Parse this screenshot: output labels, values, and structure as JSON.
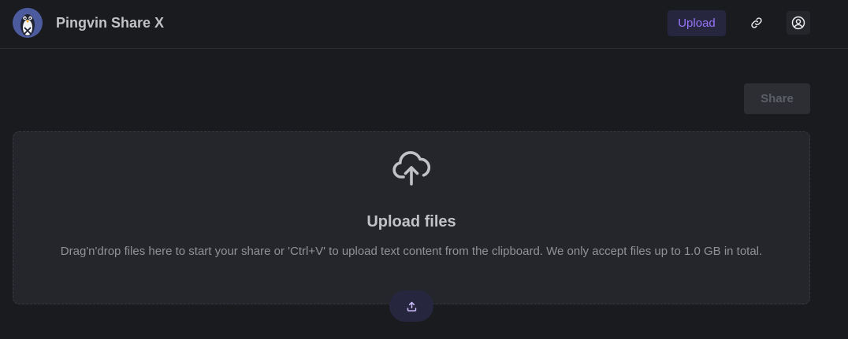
{
  "header": {
    "app_title": "Pingvin Share X",
    "logo_icon": "penguin-logo",
    "nav": {
      "upload_label": "Upload",
      "link_icon": "link-icon",
      "user_icon": "user-circle-icon"
    }
  },
  "toolbar": {
    "share_label": "Share"
  },
  "dropzone": {
    "icon": "cloud-upload-icon",
    "title": "Upload files",
    "description": "Drag'n'drop files here to start your share or 'Ctrl+V' to upload text content from the clipboard. We only accept files up to 1.0 GB in total.",
    "button_icon": "upload-icon"
  },
  "colors": {
    "background": "#1a1b1e",
    "surface": "#25262b",
    "accent": "#9775fa",
    "accent_bg": "#27263f",
    "text": "#c1c2c5",
    "muted_text": "#909296"
  }
}
